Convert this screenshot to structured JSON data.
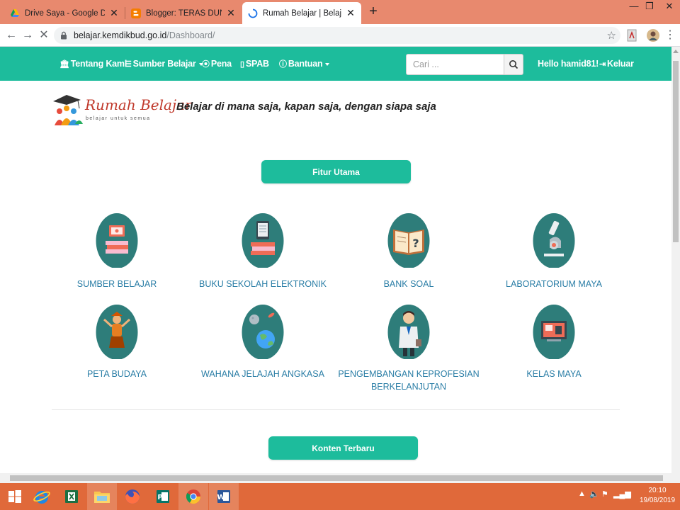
{
  "browser": {
    "tabs": [
      {
        "title": "Drive Saya - Google Drive",
        "close": "✕"
      },
      {
        "title": "Blogger: TERAS DUNIA PENDIDIKAN",
        "close": "✕"
      },
      {
        "title": "Rumah Belajar | Belajar Untuk Semua",
        "close": "✕"
      }
    ],
    "new_tab": "+",
    "window_controls": [
      "—",
      "❐",
      "✕"
    ],
    "url_host": "belajar.kemdikbud.go.id",
    "url_path": "/Dashboard/"
  },
  "nav": {
    "items": [
      "Tentang Kami",
      "Sumber Belajar",
      "Pena",
      "SPAB",
      "Bantuan"
    ],
    "search_placeholder": "Cari ...",
    "greeting": "Hello hamid81!",
    "logout": "Keluar",
    "colors": {
      "primary": "#1dbc9c"
    }
  },
  "brand": {
    "logo_text": "Rumah Belajar",
    "logo_sub": "belajar untuk semua",
    "tagline": "Belajar di mana saja, kapan saja, dengan siapa saja"
  },
  "main": {
    "featured_button": "Fitur Utama",
    "features": [
      {
        "label": "SUMBER BELAJAR",
        "icon": "books-monitor-icon"
      },
      {
        "label": "BUKU SEKOLAH ELEKTRONIK",
        "icon": "ebook-tablet-icon"
      },
      {
        "label": "BANK SOAL",
        "icon": "question-book-icon"
      },
      {
        "label": "LABORATORIUM MAYA",
        "icon": "microscope-icon"
      },
      {
        "label": "PETA BUDAYA",
        "icon": "dancer-icon"
      },
      {
        "label": "WAHANA JELAJAH ANGKASA",
        "icon": "planet-icon"
      },
      {
        "label": "PENGEMBANGAN KEPROFESIAN BERKELANJUTAN",
        "icon": "teacher-icon"
      },
      {
        "label": "KELAS MAYA",
        "icon": "classroom-icon"
      }
    ],
    "latest_button": "Konten Terbaru"
  },
  "taskbar": {
    "time": "20:10",
    "date": "19/08/2019"
  }
}
